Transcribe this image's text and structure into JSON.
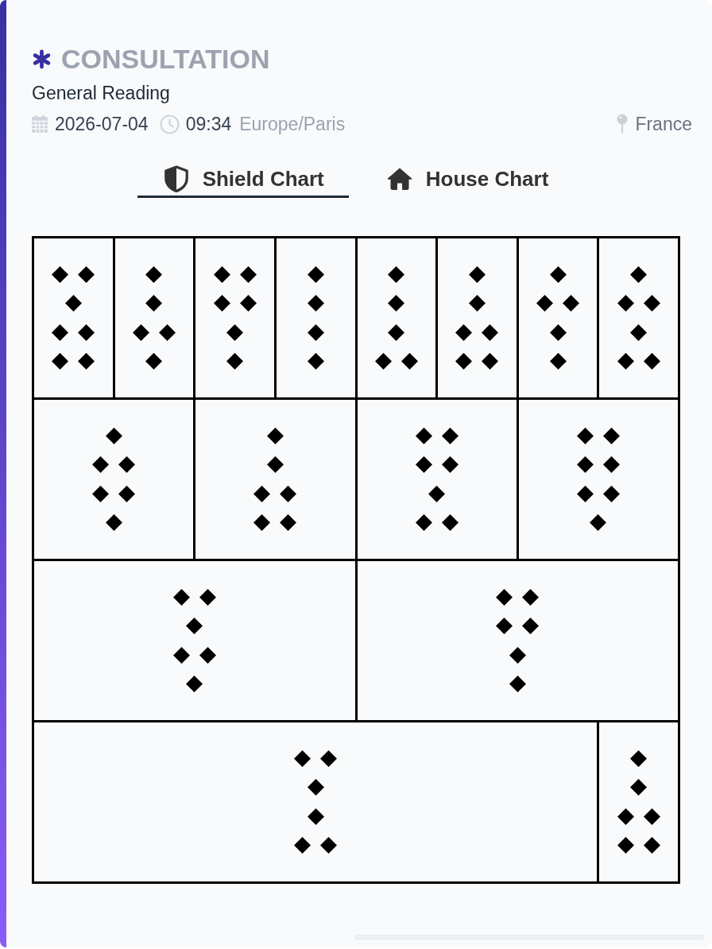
{
  "header": {
    "title": "CONSULTATION",
    "subtitle": "General Reading",
    "date": "2026-07-04",
    "time": "09:34",
    "timezone": "Europe/Paris",
    "location": "France"
  },
  "tabs": [
    {
      "label": "Shield Chart",
      "selected": true
    },
    {
      "label": "House Chart",
      "selected": false
    }
  ],
  "shield_chart": {
    "rows": [
      {
        "figures": [
          {
            "lines": [
              {
                "kind": "double"
              },
              {
                "kind": "single"
              },
              {
                "kind": "double"
              },
              {
                "kind": "double"
              }
            ]
          },
          {
            "lines": [
              {
                "kind": "single"
              },
              {
                "kind": "single"
              },
              {
                "kind": "double"
              },
              {
                "kind": "single"
              }
            ]
          },
          {
            "lines": [
              {
                "kind": "double"
              },
              {
                "kind": "double"
              },
              {
                "kind": "single"
              },
              {
                "kind": "single"
              }
            ]
          },
          {
            "lines": [
              {
                "kind": "single"
              },
              {
                "kind": "single"
              },
              {
                "kind": "single"
              },
              {
                "kind": "single"
              }
            ]
          },
          {
            "lines": [
              {
                "kind": "single"
              },
              {
                "kind": "single"
              },
              {
                "kind": "single"
              },
              {
                "kind": "double"
              }
            ]
          },
          {
            "lines": [
              {
                "kind": "single"
              },
              {
                "kind": "single"
              },
              {
                "kind": "double"
              },
              {
                "kind": "double"
              }
            ]
          },
          {
            "lines": [
              {
                "kind": "single"
              },
              {
                "kind": "double"
              },
              {
                "kind": "single"
              },
              {
                "kind": "single"
              }
            ]
          },
          {
            "lines": [
              {
                "kind": "single"
              },
              {
                "kind": "double"
              },
              {
                "kind": "single"
              },
              {
                "kind": "double"
              }
            ]
          }
        ]
      },
      {
        "figures": [
          {
            "lines": [
              {
                "kind": "single"
              },
              {
                "kind": "double"
              },
              {
                "kind": "double"
              },
              {
                "kind": "single"
              }
            ]
          },
          {
            "lines": [
              {
                "kind": "single"
              },
              {
                "kind": "single"
              },
              {
                "kind": "double"
              },
              {
                "kind": "double"
              }
            ]
          },
          {
            "lines": [
              {
                "kind": "double"
              },
              {
                "kind": "double"
              },
              {
                "kind": "single"
              },
              {
                "kind": "double"
              }
            ]
          },
          {
            "lines": [
              {
                "kind": "double"
              },
              {
                "kind": "double"
              },
              {
                "kind": "double"
              },
              {
                "kind": "single"
              }
            ]
          }
        ]
      },
      {
        "figures": [
          {
            "lines": [
              {
                "kind": "double"
              },
              {
                "kind": "single"
              },
              {
                "kind": "double"
              },
              {
                "kind": "single"
              }
            ]
          },
          {
            "lines": [
              {
                "kind": "double"
              },
              {
                "kind": "double"
              },
              {
                "kind": "single"
              },
              {
                "kind": "single"
              }
            ]
          }
        ]
      },
      {
        "figures": [
          {
            "lines": [
              {
                "kind": "double"
              },
              {
                "kind": "single"
              },
              {
                "kind": "single"
              },
              {
                "kind": "double"
              }
            ]
          },
          {
            "lines": [
              {
                "kind": "single"
              },
              {
                "kind": "single"
              },
              {
                "kind": "double"
              },
              {
                "kind": "double"
              }
            ]
          }
        ]
      }
    ]
  }
}
